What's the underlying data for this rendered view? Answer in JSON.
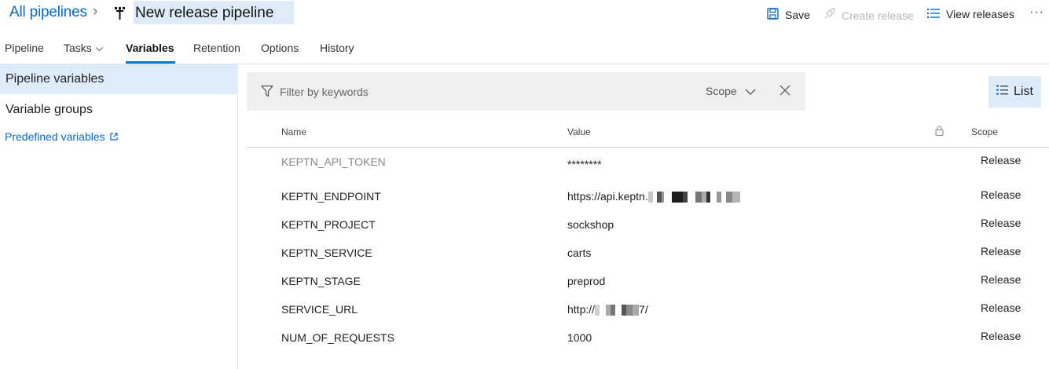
{
  "header": {
    "breadcrumb": "All pipelines",
    "title": "New release pipeline",
    "actions": {
      "save": "Save",
      "create_release": "Create release",
      "view_releases": "View releases",
      "more": "···"
    }
  },
  "tabs": [
    {
      "label": "Pipeline"
    },
    {
      "label": "Tasks"
    },
    {
      "label": "Variables"
    },
    {
      "label": "Retention"
    },
    {
      "label": "Options"
    },
    {
      "label": "History"
    }
  ],
  "sidebar": {
    "items": [
      {
        "label": "Pipeline variables"
      },
      {
        "label": "Variable groups"
      }
    ],
    "link": "Predefined variables"
  },
  "filter": {
    "placeholder": "Filter by keywords",
    "scope_label": "Scope"
  },
  "view_toggle": {
    "label": "List"
  },
  "table": {
    "columns": {
      "name": "Name",
      "value": "Value",
      "scope": "Scope"
    },
    "rows": [
      {
        "name": "KEPTN_API_TOKEN",
        "value": "********",
        "scope": "Release"
      },
      {
        "name": "KEPTN_ENDPOINT",
        "value": "https://api.keptn.",
        "scope": "Release"
      },
      {
        "name": "KEPTN_PROJECT",
        "value": "sockshop",
        "scope": "Release"
      },
      {
        "name": "KEPTN_SERVICE",
        "value": "carts",
        "scope": "Release"
      },
      {
        "name": "KEPTN_STAGE",
        "value": "preprod",
        "scope": "Release"
      },
      {
        "name": "SERVICE_URL",
        "value": "http://",
        "value_suffix": "7/",
        "scope": "Release"
      },
      {
        "name": "NUM_OF_REQUESTS",
        "value": "1000",
        "scope": "Release"
      }
    ]
  },
  "colors": {
    "accent": "#0078d4",
    "link": "#0b6abf",
    "selected_bg": "#deecf9",
    "filter_bg": "#efefef"
  }
}
